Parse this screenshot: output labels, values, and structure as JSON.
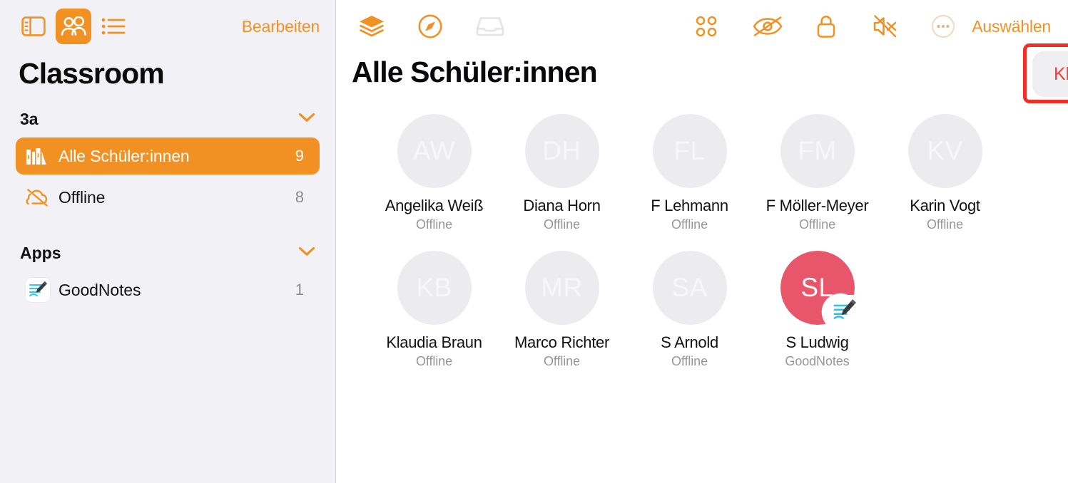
{
  "colors": {
    "accent_orange": "#F29123",
    "sidebar_bg": "#F2F1F6",
    "active_avatar": "#E8566B",
    "danger_red": "#F2403C",
    "highlight_border": "#EE3026"
  },
  "sidebar": {
    "toolbar": {
      "sidebar_toggle_icon": "sidebar-toggle-icon",
      "people_icon": "people-icon",
      "list_icon": "bullet-list-icon",
      "edit_label": "Bearbeiten"
    },
    "title": "Classroom",
    "sections": [
      {
        "label": "3a",
        "chevron": "chevron-down-icon",
        "rows": [
          {
            "icon": "books-icon",
            "label": "Alle Schüler:innen",
            "count": "9",
            "active": true
          },
          {
            "icon": "cloud-slash-icon",
            "label": "Offline",
            "count": "8",
            "active": false
          }
        ]
      },
      {
        "label": "Apps",
        "chevron": "chevron-down-icon",
        "rows": [
          {
            "icon": "goodnotes-app-icon",
            "label": "GoodNotes",
            "count": "1",
            "active": false
          }
        ]
      }
    ]
  },
  "main": {
    "toolbar_left": [
      {
        "name": "layers-icon",
        "state": "enabled"
      },
      {
        "name": "navigate-compass-icon",
        "state": "enabled"
      },
      {
        "name": "inbox-tray-icon",
        "state": "disabled"
      }
    ],
    "toolbar_right": [
      {
        "name": "app-grid-icon",
        "state": "enabled"
      },
      {
        "name": "eye-slash-icon",
        "state": "enabled"
      },
      {
        "name": "lock-icon",
        "state": "enabled"
      },
      {
        "name": "speaker-slash-icon",
        "state": "enabled"
      },
      {
        "name": "more-ellipsis-icon",
        "state": "enabled"
      }
    ],
    "select_label": "Auswählen",
    "title": "Alle Schüler:innen",
    "end_class": {
      "label": "Klasse beenden",
      "icon": "close-circle-icon",
      "highlighted": true
    },
    "students": [
      {
        "initials": "AW",
        "name": "Angelika Weiß",
        "status": "Offline",
        "active": false,
        "badge": null
      },
      {
        "initials": "DH",
        "name": "Diana Horn",
        "status": "Offline",
        "active": false,
        "badge": null
      },
      {
        "initials": "FL",
        "name": "F Lehmann",
        "status": "Offline",
        "active": false,
        "badge": null
      },
      {
        "initials": "FM",
        "name": "F Möller-Meyer",
        "status": "Offline",
        "active": false,
        "badge": null
      },
      {
        "initials": "KV",
        "name": "Karin Vogt",
        "status": "Offline",
        "active": false,
        "badge": null
      },
      {
        "initials": "KB",
        "name": "Klaudia Braun",
        "status": "Offline",
        "active": false,
        "badge": null
      },
      {
        "initials": "MR",
        "name": "Marco Richter",
        "status": "Offline",
        "active": false,
        "badge": null
      },
      {
        "initials": "SA",
        "name": "S Arnold",
        "status": "Offline",
        "active": false,
        "badge": null
      },
      {
        "initials": "SL",
        "name": "S Ludwig",
        "status": "GoodNotes",
        "active": true,
        "badge": "goodnotes-app-icon"
      }
    ]
  }
}
